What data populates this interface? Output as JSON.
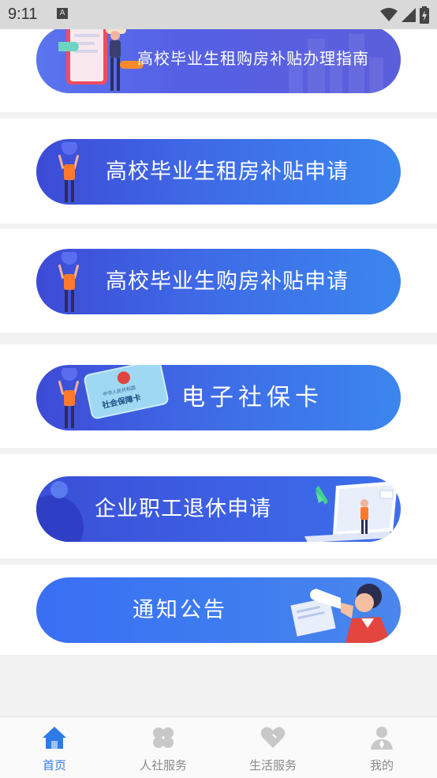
{
  "status_bar": {
    "time": "9:11",
    "notification_glyph": "A"
  },
  "banners": [
    {
      "label": "高校毕业生租购房补贴办理指南"
    },
    {
      "label": "高校毕业生租房补贴申请"
    },
    {
      "label": "高校毕业生购房补贴申请"
    },
    {
      "label": "电子社保卡",
      "card_title": "社会保障卡",
      "card_subtitle": "中华人民共和国"
    },
    {
      "label": "企业职工退休申请"
    },
    {
      "label": "通知公告"
    }
  ],
  "tabbar": {
    "items": [
      {
        "label": "首页",
        "icon": "home-icon"
      },
      {
        "label": "人社服务",
        "icon": "clover-icon"
      },
      {
        "label": "生活服务",
        "icon": "heart-icon"
      },
      {
        "label": "我的",
        "icon": "person-icon"
      }
    ],
    "active_index": 0
  },
  "colors": {
    "accent": "#2f7be5",
    "banner_start": "#3d4bd6",
    "banner_end": "#3b86ef",
    "inactive": "#8a8a8a"
  }
}
